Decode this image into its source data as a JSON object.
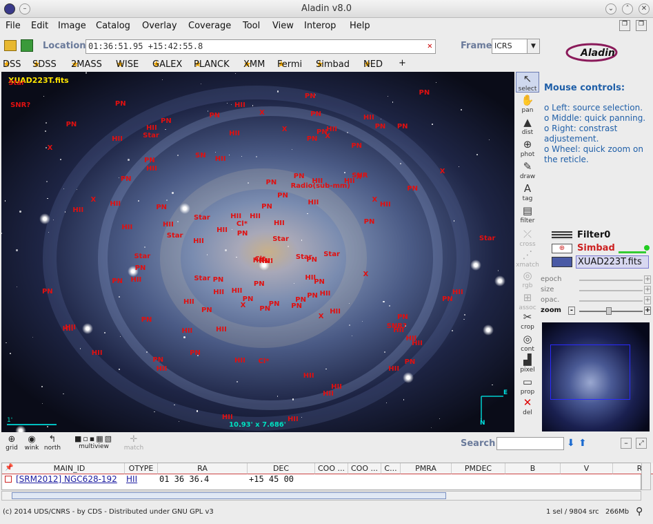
{
  "window": {
    "title": "Aladin v8.0"
  },
  "menu": [
    "File",
    "Edit",
    "Image",
    "Catalog",
    "Overlay",
    "Coverage",
    "Tool",
    "View",
    "Interop",
    "Help"
  ],
  "location": {
    "label": "Location",
    "value": "01:36:51.95 +15:42:55.8",
    "frame_label": "Frame",
    "frame_value": "ICRS"
  },
  "shortcuts": [
    "DSS",
    "SDSS",
    "2MASS",
    "WISE",
    "GALEX",
    "PLANCK",
    "XMM",
    "Fermi",
    "Simbad",
    "NED",
    "+"
  ],
  "view": {
    "image_name": "XUAD223T.fits",
    "size_label": "10.93' x 7.686'",
    "scale_label": "1'",
    "compass_e": "E",
    "compass_n": "N"
  },
  "tools": [
    {
      "label": "select",
      "icon": "cursor-icon",
      "enabled": true
    },
    {
      "label": "pan",
      "icon": "hand-icon",
      "enabled": true
    },
    {
      "label": "dist",
      "icon": "distance-icon",
      "enabled": true
    },
    {
      "label": "phot",
      "icon": "crosshair-icon",
      "enabled": true
    },
    {
      "label": "draw",
      "icon": "pencil-icon",
      "enabled": true
    },
    {
      "label": "tag",
      "icon": "tag-icon",
      "enabled": true
    },
    {
      "label": "filter",
      "icon": "filter-icon",
      "enabled": true
    },
    {
      "label": "cross",
      "icon": "cross-icon",
      "enabled": false
    },
    {
      "label": "xmatch",
      "icon": "xmatch-icon",
      "enabled": false
    },
    {
      "label": "rgb",
      "icon": "rgb-icon",
      "enabled": false
    },
    {
      "label": "assoc",
      "icon": "assoc-icon",
      "enabled": false
    },
    {
      "label": "crop",
      "icon": "scissors-icon",
      "enabled": true
    },
    {
      "label": "cont",
      "icon": "contour-icon",
      "enabled": true
    },
    {
      "label": "pixel",
      "icon": "histogram-icon",
      "enabled": true
    },
    {
      "label": "prop",
      "icon": "properties-icon",
      "enabled": true
    },
    {
      "label": "del",
      "icon": "delete-icon",
      "enabled": true
    }
  ],
  "mouse_controls": {
    "title": "Mouse controls:",
    "items": [
      "o Left: source selection.",
      "o Middle: quick panning.",
      "o Right: constrast adjustement.",
      "o Wheel: quick zoom on the reticle."
    ]
  },
  "layers": [
    "Filter0",
    "Simbad",
    "XUAD223T.fits"
  ],
  "sliders": [
    "epoch",
    "size",
    "opac.",
    "zoom"
  ],
  "bottom_tools": [
    "grid",
    "wink",
    "north",
    "multiview",
    "match"
  ],
  "search": {
    "label": "Search",
    "value": ""
  },
  "table": {
    "columns": [
      "MAIN_ID",
      "OTYPE",
      "RA",
      "DEC",
      "COO ...",
      "COO ...",
      "C...",
      "PMRA",
      "PMDEC",
      "B",
      "V",
      "R"
    ],
    "rows": [
      [
        "[SRM2012] NGC628-192",
        "HII",
        "01 36 36.4",
        "+15 45 00",
        "",
        "",
        "",
        "",
        "",
        "",
        "",
        ""
      ]
    ]
  },
  "status": {
    "copyright": "(c) 2014 UDS/CNRS - by CDS - Distributed under GNU GPL v3",
    "selection": "1 sel / 9804 src",
    "memory": "266Mb"
  },
  "colors": {
    "marker": "#e01010",
    "accent": "#1f5fa8",
    "simbad": "#cc2020"
  },
  "labels": [
    "X",
    "PN",
    "PN",
    "PN",
    "X",
    "SNR?",
    "Star",
    "PN",
    "X",
    "SNR",
    "X",
    "PN",
    "Radio(sub-mm)",
    "PN",
    "PN",
    "PN",
    "PN",
    "HII",
    "HII",
    "PN",
    "HII",
    "HII",
    "Star",
    "X",
    "PN",
    "SN",
    "PN",
    "PN",
    "HII",
    "HII",
    "PN",
    "PN",
    "PN",
    "HII",
    "HII",
    "HII",
    "PN",
    "SNR?",
    "PN",
    "PN",
    "PN",
    "PN",
    "HII",
    "HII",
    "Cl*",
    "HII",
    "HII",
    "HII",
    "PN",
    "PN",
    "X",
    "PN",
    "HII",
    "HII",
    "HII",
    "HII",
    "Star",
    "PN",
    "PN",
    "HII",
    "HII",
    "HII",
    "PN",
    "HII",
    "PN",
    "PN",
    "HII",
    "HII",
    "Cl*",
    "HII",
    "HII",
    "HII",
    "HII",
    "PN",
    "PN",
    "PN",
    "HII",
    "HII",
    "HII",
    "HII",
    "Star",
    "PN",
    "Star",
    "Star",
    "PN",
    "HII",
    "HII",
    "PN",
    "Star",
    "PN",
    "PN",
    "HII",
    "HII",
    "HII",
    "PN",
    "HII",
    "X",
    "HII",
    "X",
    "X",
    "X",
    "PN",
    "X",
    "Cl*",
    "HII",
    "PN",
    "HII",
    "HII",
    "HII",
    "HII",
    "PN",
    "HII",
    "Star",
    "Star",
    "PN",
    "PN",
    "HII",
    "HII",
    "Star"
  ]
}
